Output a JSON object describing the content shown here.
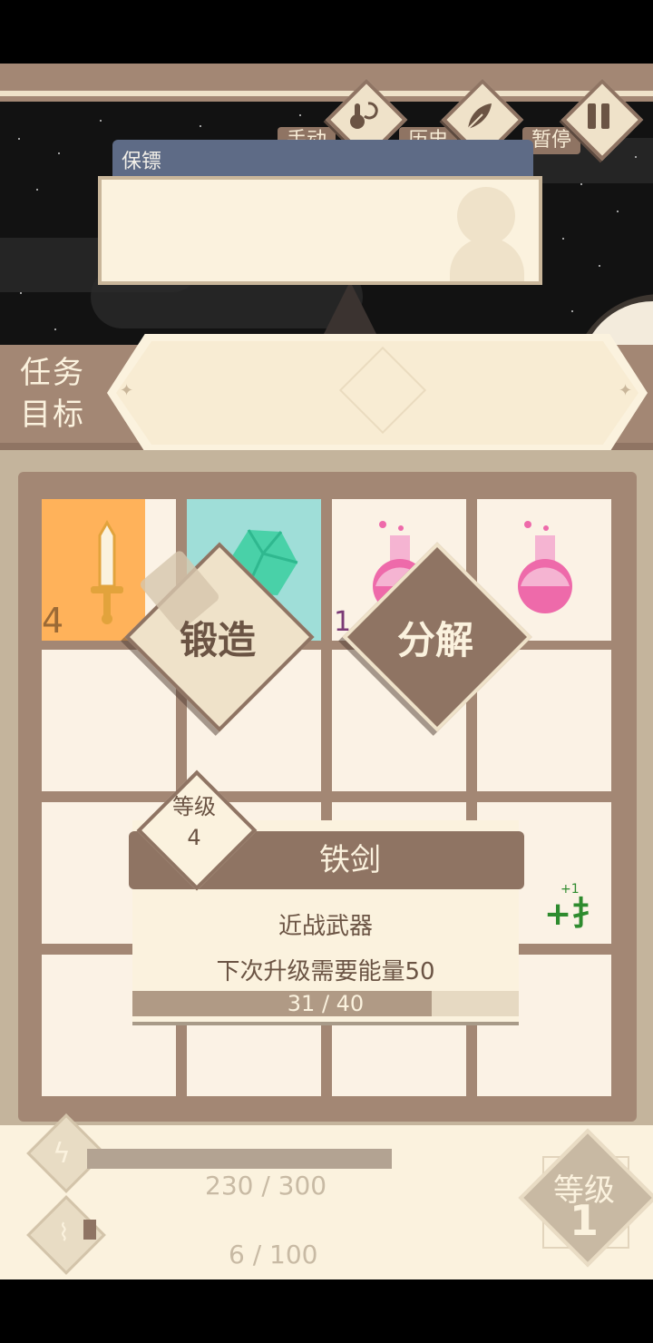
{
  "controls": {
    "manual_label": "手动",
    "history_label": "历史",
    "pause_label": "暂停"
  },
  "bodyguard": {
    "label": "保镖"
  },
  "mission": {
    "label_line1": "任务",
    "label_line2": "目标"
  },
  "inventory": {
    "slots": [
      {
        "item": "sword-icon",
        "count": "4",
        "color": "#ffb25a"
      },
      {
        "item": "gem-icon",
        "count": "",
        "color": "#9fded8"
      },
      {
        "item": "potion-icon",
        "count": "1",
        "color": "#fbf2e5"
      },
      {
        "item": "potion-icon",
        "count": "",
        "color": "#fbf2e5"
      }
    ]
  },
  "actions": {
    "forge_label": "锻造",
    "decompose_label": "分解"
  },
  "item_card": {
    "level_label": "等级",
    "level_value": "4",
    "name": "铁剑",
    "type": "近战武器",
    "next_upgrade": "下次升级需要能量50",
    "progress_text": "31 / 40",
    "progress_fraction": 0.775
  },
  "bonus": {
    "small": "+1",
    "glyph": "+扌"
  },
  "stats": {
    "energy_text": "230 / 300",
    "energy_fraction": 0.77,
    "exp_text": "6 / 100",
    "exp_fraction": 0.06
  },
  "player_level": {
    "label": "等级",
    "value": "1"
  },
  "colors": {
    "panel": "#a38774",
    "cream": "#fbf2de",
    "accent_orange": "#ffb25a",
    "teal": "#9fded8"
  }
}
